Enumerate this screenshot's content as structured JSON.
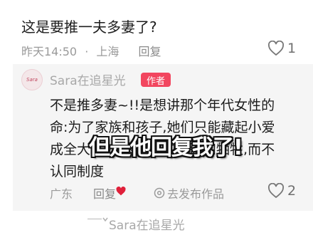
{
  "comment": {
    "text": "这是要推一夫多妻了?",
    "time": "昨天14:50",
    "dot": "·",
    "location": "上海",
    "reply_label": "回复",
    "likes": "1"
  },
  "reply": {
    "avatar_text": "Sara",
    "username": "Sara在追星光",
    "badge": "作者",
    "lines": [
      "不是推多妻~!!是想讲那个年代女性的",
      "命:为了家族和孩子,她们只能藏起小爱",
      "成全大局,心疼她们的隐忍和牺牲,而不",
      "认同制度"
    ],
    "location": "广东",
    "reply_label": "回复",
    "publish_label": "去发布作品",
    "likes": "2"
  },
  "overlay_caption": "但是他回复我了!",
  "next_reply": {
    "username": "Sara在追星光"
  },
  "colors": {
    "badge": "#f2465f",
    "card_bg": "#f5f5f5",
    "muted": "#9a9a9a",
    "heart_red": "#e0203a"
  }
}
